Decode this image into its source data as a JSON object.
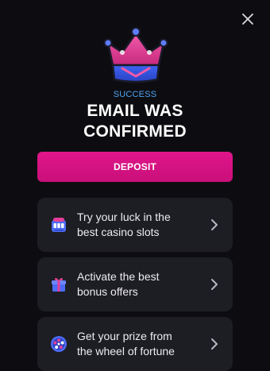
{
  "modal": {
    "status": "SUCCESS",
    "title_lines": [
      "EMAIL WAS",
      "CONFIRMED"
    ],
    "deposit_label": "DEPOSIT",
    "close_icon": "close-icon",
    "hero_icon": "crown-icon"
  },
  "offers": [
    {
      "icon": "slot-machine-icon",
      "lines": [
        "Try your luck in the",
        "best casino slots"
      ]
    },
    {
      "icon": "gift-icon",
      "lines": [
        "Activate the best",
        "bonus offers"
      ]
    },
    {
      "icon": "fortune-wheel-icon",
      "lines": [
        "Get your prize from",
        "the wheel of fortune"
      ]
    }
  ],
  "colors": {
    "background": "#0d0d11",
    "accent": "#e0168a",
    "status": "#4ea4f5",
    "card": "#1d1d24"
  }
}
